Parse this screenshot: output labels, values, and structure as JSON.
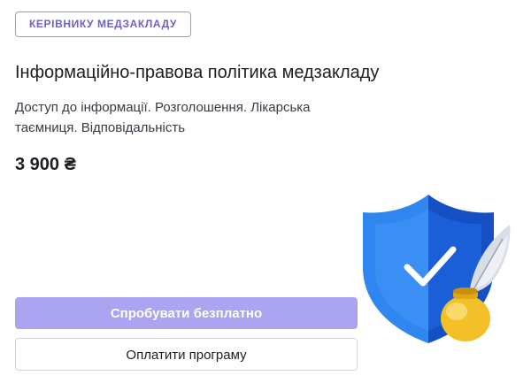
{
  "card": {
    "tag": "КЕРІВНИКУ МЕДЗАКЛАДУ",
    "title": "Інформаційно-правова політика медзакладу",
    "subtitle": "Доступ до інформації. Розголошення. Лікарська таємниця. Відповідальність",
    "price": "3 900 ₴"
  },
  "actions": {
    "try_label": "Спробувати безплатно",
    "pay_label": "Оплатити програму"
  },
  "illustration": {
    "icons": [
      "shield-check-icon",
      "quill-inkwell-icon"
    ]
  },
  "colors": {
    "accent": "#aba4f1",
    "tag_text": "#6b61c7",
    "tag_border": "#9e97d8",
    "shield_blue": "#1f6fe0",
    "ink_gold": "#f4c02a"
  }
}
